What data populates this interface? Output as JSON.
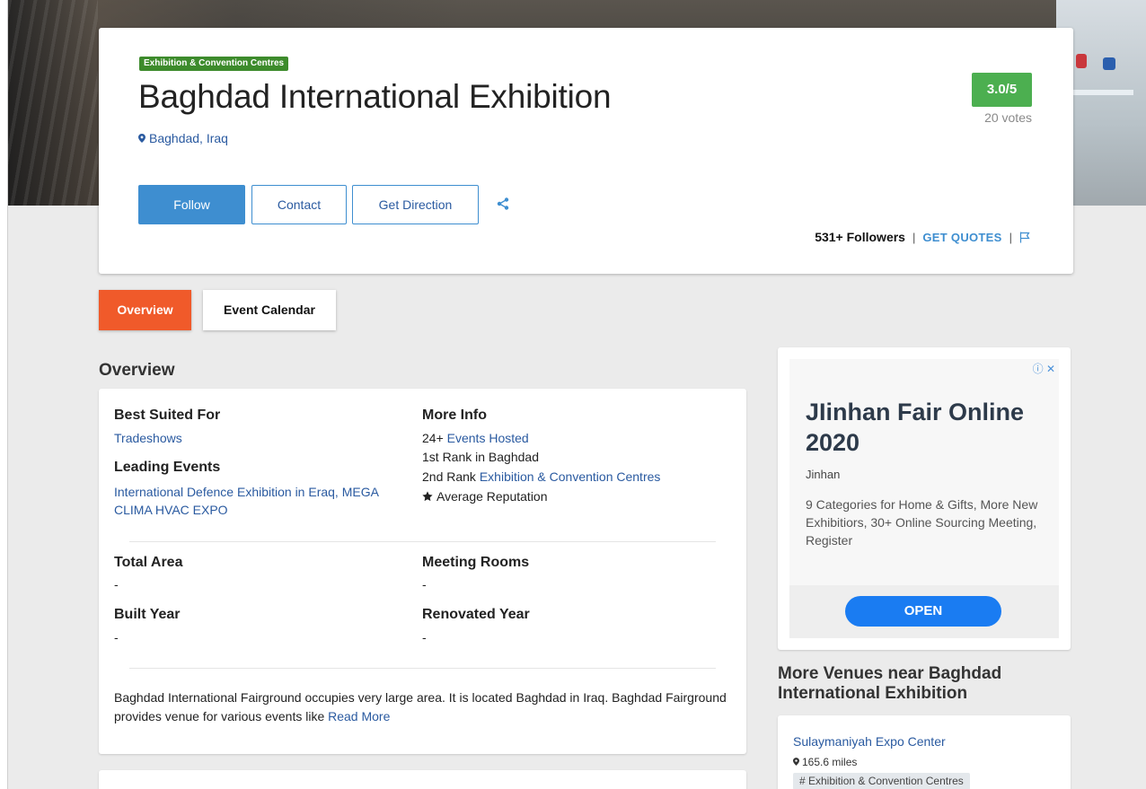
{
  "header": {
    "category": "Exhibition & Convention Centres",
    "title": "Baghdad International Exhibition",
    "location": "Baghdad, Iraq",
    "rating": "3.0/5",
    "votes": "20 votes",
    "buttons": {
      "follow": "Follow",
      "contact": "Contact",
      "direction": "Get Direction"
    },
    "followers": "531+ Followers",
    "separator": "|",
    "get_quotes": "GET QUOTES"
  },
  "tabs": {
    "overview": "Overview",
    "calendar": "Event Calendar"
  },
  "overview": {
    "heading": "Overview",
    "best_suited_label": "Best Suited For",
    "best_suited_value": "Tradeshows",
    "leading_events_label": "Leading Events",
    "leading_events_value": "International Defence Exhibition in Eraq, MEGA CLIMA HVAC EXPO",
    "more_info_label": "More Info",
    "events_hosted_prefix": "24+",
    "events_hosted_link": "Events Hosted",
    "rank_city": "1st Rank in Baghdad",
    "rank_category_prefix": "2nd Rank",
    "rank_category_link": "Exhibition & Convention Centres",
    "reputation": "Average Reputation",
    "total_area_label": "Total Area",
    "total_area_value": "-",
    "meeting_rooms_label": "Meeting Rooms",
    "meeting_rooms_value": "-",
    "built_year_label": "Built Year",
    "built_year_value": "-",
    "renovated_year_label": "Renovated Year",
    "renovated_year_value": "-",
    "description": "Baghdad International Fairground occupies very large area. It is located Baghdad in Iraq. Baghdad Fairground provides venue for various events like",
    "read_more": "Read More"
  },
  "ad": {
    "title": "JIinhan Fair Online 2020",
    "advertiser": "Jinhan",
    "description": "9 Categories for Home & Gifts, More New Exhibitiors, 30+ Online Sourcing Meeting, Register",
    "cta": "OPEN",
    "icons": "ⓘ ✕"
  },
  "nearby": {
    "heading": "More Venues near Baghdad International Exhibition",
    "venues": [
      {
        "name": "Sulaymaniyah Expo Center",
        "distance": "165.6 miles",
        "tag": "# Exhibition & Convention Centres"
      }
    ]
  }
}
